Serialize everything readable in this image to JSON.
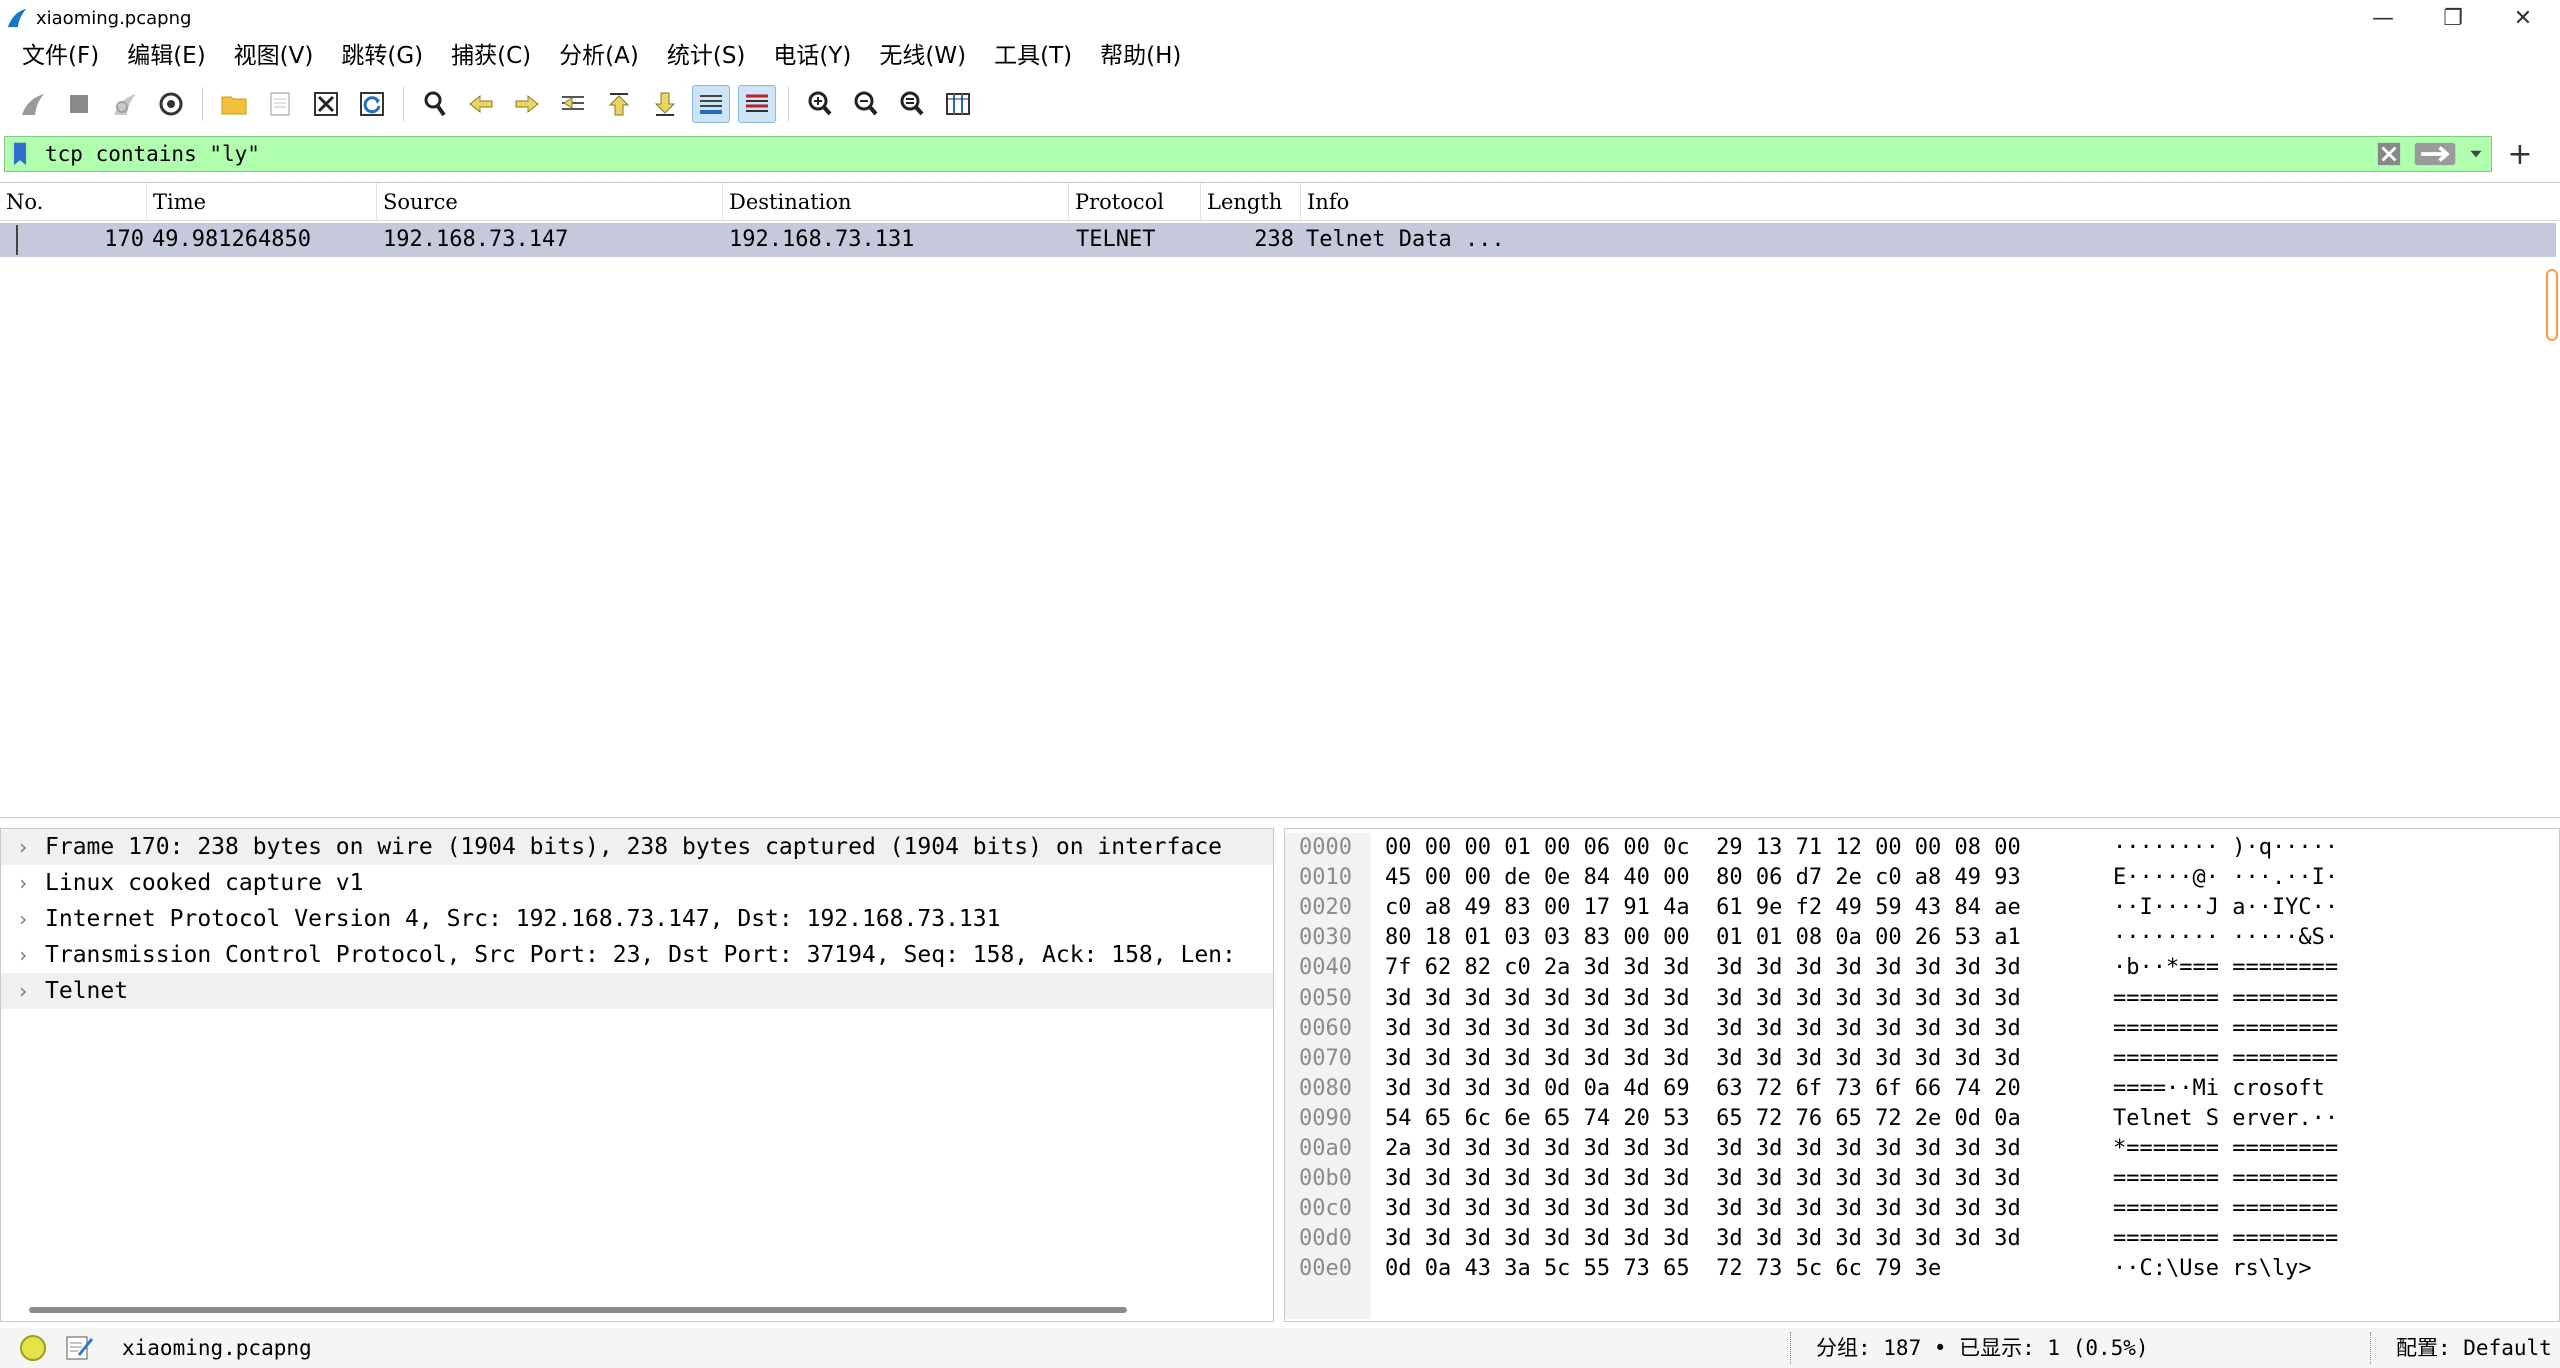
{
  "window": {
    "title": "xiaoming.pcapng",
    "minimize": "—",
    "maximize": "❐",
    "close": "✕"
  },
  "menu": [
    "文件(F)",
    "编辑(E)",
    "视图(V)",
    "跳转(G)",
    "捕获(C)",
    "分析(A)",
    "统计(S)",
    "电话(Y)",
    "无线(W)",
    "工具(T)",
    "帮助(H)"
  ],
  "filter": {
    "value": "tcp contains \"ly\"",
    "bg_color": "#afffaf"
  },
  "packet_list": {
    "columns": [
      "No.",
      "Time",
      "Source",
      "Destination",
      "Protocol",
      "Length",
      "Info"
    ],
    "rows": [
      {
        "no": "170",
        "time": "49.981264850",
        "source": "192.168.73.147",
        "destination": "192.168.73.131",
        "protocol": "TELNET",
        "length": "238",
        "info": "Telnet Data ..."
      }
    ]
  },
  "detail": [
    "Frame 170: 238 bytes on wire (1904 bits), 238 bytes captured (1904 bits) on interface",
    "Linux cooked capture v1",
    "Internet Protocol Version 4, Src: 192.168.73.147, Dst: 192.168.73.131",
    "Transmission Control Protocol, Src Port: 23, Dst Port: 37194, Seq: 158, Ack: 158, Len:",
    "Telnet"
  ],
  "bytes": [
    {
      "off": "0000",
      "hex": "00 00 00 01 00 06 00 0c  29 13 71 12 00 00 08 00",
      "ascii": "········ )·q·····"
    },
    {
      "off": "0010",
      "hex": "45 00 00 de 0e 84 40 00  80 06 d7 2e c0 a8 49 93",
      "ascii": "E·····@· ···.··I·"
    },
    {
      "off": "0020",
      "hex": "c0 a8 49 83 00 17 91 4a  61 9e f2 49 59 43 84 ae",
      "ascii": "··I····J a··IYC··"
    },
    {
      "off": "0030",
      "hex": "80 18 01 03 03 83 00 00  01 01 08 0a 00 26 53 a1",
      "ascii": "········ ·····&S·"
    },
    {
      "off": "0040",
      "hex": "7f 62 82 c0 2a 3d 3d 3d  3d 3d 3d 3d 3d 3d 3d 3d",
      "ascii": "·b··*=== ========"
    },
    {
      "off": "0050",
      "hex": "3d 3d 3d 3d 3d 3d 3d 3d  3d 3d 3d 3d 3d 3d 3d 3d",
      "ascii": "======== ========"
    },
    {
      "off": "0060",
      "hex": "3d 3d 3d 3d 3d 3d 3d 3d  3d 3d 3d 3d 3d 3d 3d 3d",
      "ascii": "======== ========"
    },
    {
      "off": "0070",
      "hex": "3d 3d 3d 3d 3d 3d 3d 3d  3d 3d 3d 3d 3d 3d 3d 3d",
      "ascii": "======== ========"
    },
    {
      "off": "0080",
      "hex": "3d 3d 3d 3d 0d 0a 4d 69  63 72 6f 73 6f 66 74 20",
      "ascii": "====··Mi crosoft "
    },
    {
      "off": "0090",
      "hex": "54 65 6c 6e 65 74 20 53  65 72 76 65 72 2e 0d 0a",
      "ascii": "Telnet S erver.··"
    },
    {
      "off": "00a0",
      "hex": "2a 3d 3d 3d 3d 3d 3d 3d  3d 3d 3d 3d 3d 3d 3d 3d",
      "ascii": "*======= ========"
    },
    {
      "off": "00b0",
      "hex": "3d 3d 3d 3d 3d 3d 3d 3d  3d 3d 3d 3d 3d 3d 3d 3d",
      "ascii": "======== ========"
    },
    {
      "off": "00c0",
      "hex": "3d 3d 3d 3d 3d 3d 3d 3d  3d 3d 3d 3d 3d 3d 3d 3d",
      "ascii": "======== ========"
    },
    {
      "off": "00d0",
      "hex": "3d 3d 3d 3d 3d 3d 3d 3d  3d 3d 3d 3d 3d 3d 3d 3d",
      "ascii": "======== ========"
    },
    {
      "off": "00e0",
      "hex": "0d 0a 43 3a 5c 55 73 65  72 73 5c 6c 79 3e",
      "ascii": "··C:\\Use rs\\ly>"
    }
  ],
  "status": {
    "file": "xiaoming.pcapng",
    "packets": "分组: 187 • 已显示: 1 (0.5%)",
    "profile": "配置: Default"
  },
  "icons": {
    "app": "wireshark-fin-icon",
    "status_led": "ready-indicator-icon",
    "status_edit": "capture-comment-icon"
  },
  "colors": {
    "selected_row": "#c6c8dc",
    "filter_ok": "#afffaf",
    "scroll_marker": "#ff9a3c"
  }
}
